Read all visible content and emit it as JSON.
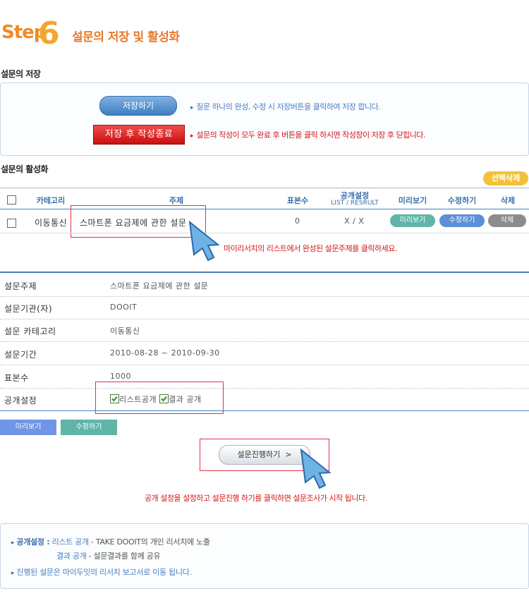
{
  "header": {
    "step_label": "Step6",
    "title": "설문의 저장 및 활성화"
  },
  "save_section": {
    "title": "설문의 저장",
    "save_button": "저장하기",
    "save_note": "질문 하나의 완성, 수정 시 저장버튼을 클릭하여 저장 합니다.",
    "save_close_button": "저장 후 작성종료",
    "save_close_note": "설문의 작성이 모두 완료 후 버튼을 클릭 하시면 작성창이 저장 후 닫힙니다."
  },
  "activation_section": {
    "title": "설문의 활성화",
    "select_delete_button": "선택삭제",
    "columns": {
      "category": "카테고리",
      "subject": "주제",
      "sample": "표본수",
      "public": "공개설정",
      "public_sub": "LIST / RESRULT",
      "preview": "미리보기",
      "edit": "수정하기",
      "delete": "삭제"
    },
    "row": {
      "category": "이동통신",
      "subject": "스마트폰 요금제에 관한 설문",
      "sample": "0",
      "public": "X / X",
      "preview": "미리보기",
      "edit": "수정하기",
      "delete": "삭제"
    },
    "hint": "마이리서치의 리스트에서 완성된 설문주제를 클릭하세요."
  },
  "detail": {
    "rows": [
      {
        "label": "설문주제",
        "value": "스마트폰 요금제에 관한 설문"
      },
      {
        "label": "설문기관(자)",
        "value": "DOOIT"
      },
      {
        "label": "설문 카테고리",
        "value": "이동통신"
      },
      {
        "label": "설문기간",
        "value": "2010-08-28 ~ 2010-09-30"
      },
      {
        "label": "표본수",
        "value": "1000"
      },
      {
        "label": "공개설정",
        "value": ""
      }
    ],
    "public_list": "리스트공개",
    "public_result": "결과 공개",
    "preview_button": "미리보기",
    "edit_button": "수정하기",
    "proceed_button": "설문진행하기",
    "proceed_arrow": ">",
    "proceed_note": "공개 설정을 설정하고 설문진행 하기를 클릭하면 설문조사가 시작 됩니다."
  },
  "footer": {
    "label1": "공개설정 :",
    "link1": "리스트 공개",
    "text1": " - TAKE DOOIT의 개인 리서치에 노출",
    "link2": "결과 공개",
    "text2": " - 설문결과를 함께 공유",
    "line3": "진행된 설문은 마이두잇의 리서치 보고서로 이동 됩니다."
  },
  "colors": {
    "accent_orange": "#e8792b",
    "blue": "#4a7fc1",
    "red": "#d51818",
    "teal": "#5fb5a8",
    "gray": "#8c8c8c",
    "yellow": "#f2c23a"
  }
}
